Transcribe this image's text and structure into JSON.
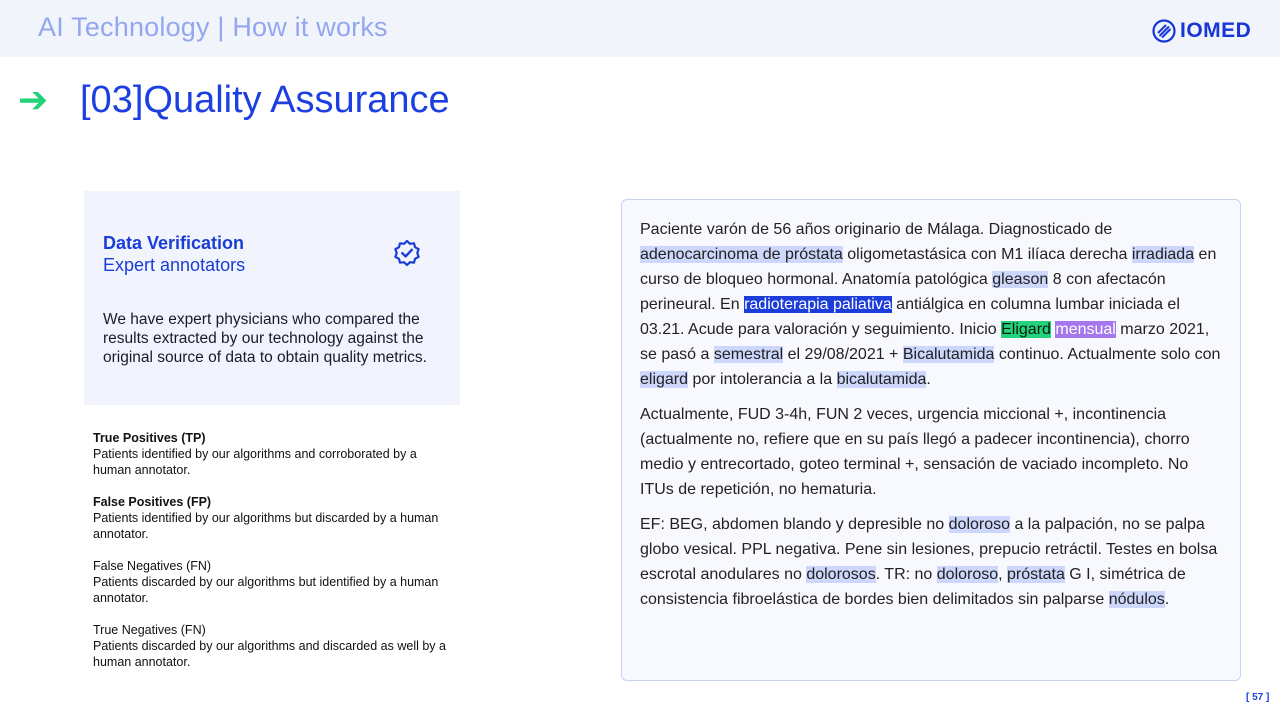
{
  "header": {
    "title": "AI Technology | How it works",
    "logo_text": "IOMED"
  },
  "section": {
    "arrow": "➔",
    "title": "[03]Quality Assurance"
  },
  "card": {
    "heading": "Data Verification",
    "subheading": "Expert annotators",
    "body": "We have expert physicians who compared the results extracted by our technology against the original source of data to obtain quality metrics.",
    "icon": "verified-badge-icon"
  },
  "definitions": [
    {
      "term": "True Positives (TP)",
      "desc": "Patients identified by our algorithms and corroborated by a human annotator."
    },
    {
      "term": "False Positives (FP)",
      "desc": "Patients identified by our algorithms but discarded by a human annotator."
    },
    {
      "term": "False Negatives (FN)",
      "desc": "Patients discarded by our algorithms but identified by a human annotator."
    },
    {
      "term": "True Negatives (FN)",
      "desc": "Patients discarded by our algorithms and discarded as well by a human annotator."
    }
  ],
  "clinical_text": {
    "p1": [
      {
        "t": "Paciente varón de 56 años originario de Málaga. Diagnosticado de "
      },
      {
        "t": "adenocarcinoma de próstata",
        "hl": "light"
      },
      {
        "t": " oligometastásica con M1 ilíaca derecha "
      },
      {
        "t": "irradiada",
        "hl": "light"
      },
      {
        "t": " en curso de bloqueo hormonal. Anatomía patológica "
      },
      {
        "t": "gleason",
        "hl": "light"
      },
      {
        "t": " 8 con afectacón perineural. En "
      },
      {
        "t": "radioterapia paliativa",
        "hl": "blue"
      },
      {
        "t": " antiálgica en columna lumbar iniciada el 03.21. Acude para valoración y seguimiento. Inicio "
      },
      {
        "t": "Eligard",
        "hl": "green"
      },
      {
        "t": " "
      },
      {
        "t": "mensual",
        "hl": "purple"
      },
      {
        "t": " marzo 2021, se pasó a "
      },
      {
        "t": "semestral",
        "hl": "light"
      },
      {
        "t": " el 29/08/2021 + "
      },
      {
        "t": "Bicalutamida",
        "hl": "light"
      },
      {
        "t": " continuo. Actualmente solo con "
      },
      {
        "t": "eligard",
        "hl": "light"
      },
      {
        "t": " por intolerancia a la "
      },
      {
        "t": "bicalutamida",
        "hl": "light"
      },
      {
        "t": "."
      }
    ],
    "p2": "Actualmente, FUD 3-4h, FUN 2 veces, urgencia miccional +, incontinencia (actualmente no, refiere que en su país llegó a padecer incontinencia), chorro medio y entrecortado, goteo terminal +, sensación de vaciado incompleto. No ITUs de repetición, no hematuria.",
    "p3": [
      {
        "t": "EF: BEG, abdomen blando y depresible no "
      },
      {
        "t": "doloroso",
        "hl": "light"
      },
      {
        "t": " a la palpación, no se palpa globo vesical. PPL negativa. Pene sin lesiones, prepucio retráctil. Testes en bolsa escrotal anodulares no "
      },
      {
        "t": "dolorosos",
        "hl": "light"
      },
      {
        "t": ". TR: no "
      },
      {
        "t": "doloroso",
        "hl": "light"
      },
      {
        "t": ", "
      },
      {
        "t": "próstata",
        "hl": "light"
      },
      {
        "t": " G I, simétrica de consistencia fibroelástica de bordes bien delimitados sin palparse "
      },
      {
        "t": "nódulos",
        "hl": "light"
      },
      {
        "t": "."
      }
    ]
  },
  "page_number": "[ 57 ]",
  "colors": {
    "accent_blue": "#1b3fe0",
    "accent_green": "#22d37a",
    "highlight_light": "#cdd6fb",
    "highlight_purple": "#a577ec",
    "header_bg": "#f1f4fb"
  }
}
